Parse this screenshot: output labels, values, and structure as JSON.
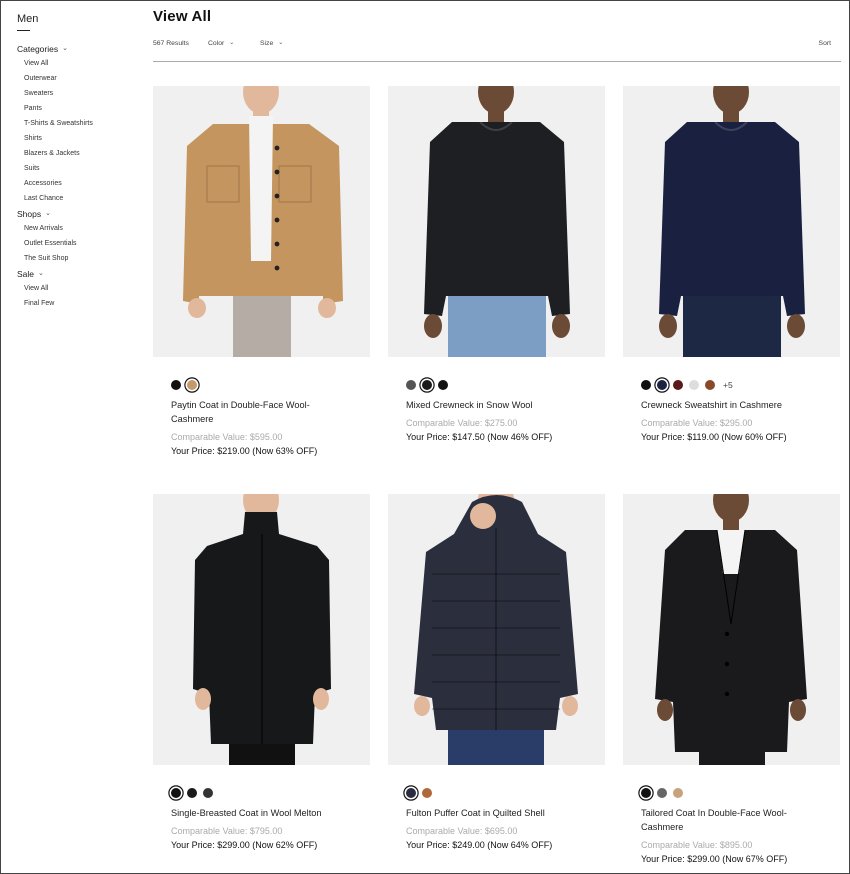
{
  "sidebar": {
    "title": "Men",
    "sections": [
      {
        "label": "Categories",
        "items": [
          "View All",
          "Outerwear",
          "Sweaters",
          "Pants",
          "T-Shirts & Sweatshirts",
          "Shirts",
          "Blazers & Jackets",
          "Suits",
          "Accessories",
          "Last Chance"
        ]
      },
      {
        "label": "Shops",
        "items": [
          "New Arrivals",
          "Outlet Essentials",
          "The Suit Shop"
        ]
      },
      {
        "label": "Sale",
        "items": [
          "View All",
          "Final Few"
        ]
      }
    ]
  },
  "header": {
    "title": "View All",
    "results": "567 Results",
    "filters": [
      "Color",
      "Size"
    ],
    "sort_label": "Sort"
  },
  "products": [
    {
      "name": "Paytin Coat in Double-Face Wool-Cashmere",
      "comparable": "Comparable Value: $595.00",
      "price": "Your Price: $219.00 (Now 63% OFF)",
      "swatches": [
        "#111111",
        "#c49a6c"
      ],
      "selected_swatch": 1,
      "more": ""
    },
    {
      "name": "Mixed Crewneck in Snow Wool",
      "comparable": "Comparable Value: $275.00",
      "price": "Your Price: $147.50 (Now 46% OFF)",
      "swatches": [
        "#555555",
        "#1a1a1a",
        "#111111"
      ],
      "selected_swatch": 1,
      "more": ""
    },
    {
      "name": "Crewneck Sweatshirt in Cashmere",
      "comparable": "Comparable Value: $295.00",
      "price": "Your Price: $119.00 (Now 60% OFF)",
      "swatches": [
        "#111111",
        "#1c2340",
        "#5a1a1a",
        "#dddddd",
        "#8a4a2a"
      ],
      "selected_swatch": 1,
      "more": "+5"
    },
    {
      "name": "Single-Breasted Coat in Wool Melton",
      "comparable": "Comparable Value: $795.00",
      "price": "Your Price: $299.00 (Now 62% OFF)",
      "swatches": [
        "#111111",
        "#1a1a1a",
        "#333333"
      ],
      "selected_swatch": 0,
      "more": ""
    },
    {
      "name": "Fulton Puffer Coat in Quilted Shell",
      "comparable": "Comparable Value: $695.00",
      "price": "Your Price: $249.00 (Now 64% OFF)",
      "swatches": [
        "#2a2d40",
        "#b0683a"
      ],
      "selected_swatch": 0,
      "more": ""
    },
    {
      "name": "Tailored Coat In Double-Face Wool-Cashmere",
      "comparable": "Comparable Value: $895.00",
      "price": "Your Price: $299.00 (Now 67% OFF)",
      "swatches": [
        "#111111",
        "#666666",
        "#c8a27a"
      ],
      "selected_swatch": 0,
      "more": ""
    }
  ],
  "product_images": [
    {
      "garment": "shirt-jacket",
      "coat": "#c4955f",
      "inner": "#f4f4f4",
      "pants": "#b5aca6",
      "skin": "#e2b89d"
    },
    {
      "garment": "crewneck",
      "coat": "#1d1f22",
      "inner": "#1d1f22",
      "pants": "#7c9ec4",
      "skin": "#6b4a36"
    },
    {
      "garment": "crewneck",
      "coat": "#1a2140",
      "inner": "#1a2140",
      "pants": "#1d2845",
      "skin": "#6b4a36"
    },
    {
      "garment": "long-coat",
      "coat": "#17181a",
      "inner": "#17181a",
      "pants": "#111111",
      "skin": "#e2b89d"
    },
    {
      "garment": "puffer",
      "coat": "#2b2f3d",
      "inner": "#2b2f3d",
      "pants": "#2a3d68",
      "skin": "#e2b89d"
    },
    {
      "garment": "open-coat",
      "coat": "#1a1a1c",
      "inner": "#f4f4f4",
      "pants": "#1a1a1c",
      "skin": "#6b4a36"
    }
  ]
}
